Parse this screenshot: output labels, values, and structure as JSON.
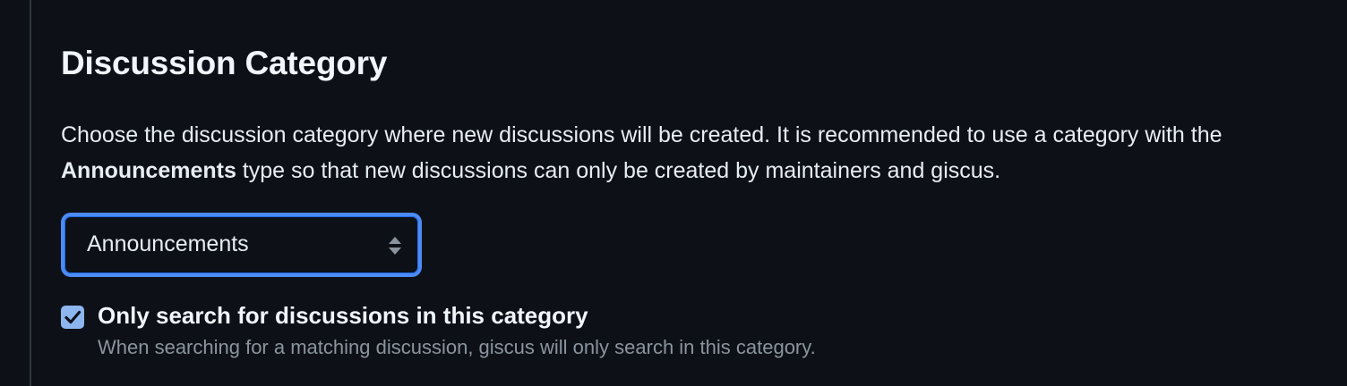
{
  "section": {
    "title": "Discussion Category",
    "description_before": "Choose the discussion category where new discussions will be created. It is recommended to use a category with the ",
    "description_bold": "Announcements",
    "description_after": " type so that new discussions can only be created by maintainers and giscus."
  },
  "category_select": {
    "selected": "Announcements",
    "icon": "select-arrows-icon",
    "focus_color": "#4c8bf5"
  },
  "strict_search": {
    "checked": true,
    "label": "Only search for discussions in this category",
    "help": "When searching for a matching discussion, giscus will only search in this category.",
    "check_color": "#8db5ee"
  },
  "colors": {
    "background": "#0d1117",
    "text": "#e6edf3",
    "muted": "#8b949e",
    "rule": "#30363d"
  }
}
